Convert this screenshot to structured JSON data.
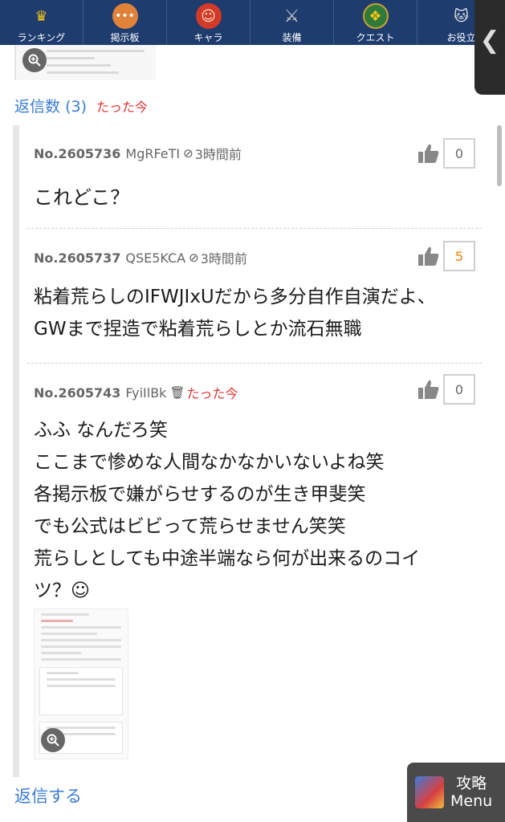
{
  "nav": {
    "items": [
      {
        "label": "ランキング",
        "icon": "crown-icon",
        "color": "#f5c518"
      },
      {
        "label": "掲示板",
        "icon": "chat-bubble-icon",
        "color": "#e0823a"
      },
      {
        "label": "キャラ",
        "icon": "character-face-icon",
        "color": "#d23a2a"
      },
      {
        "label": "装備",
        "icon": "sword-icon",
        "color": "#b8b8b8"
      },
      {
        "label": "クエスト",
        "icon": "quest-emblem-icon",
        "color": "#c8a030"
      },
      {
        "label": "お役立",
        "icon": "cat-icon",
        "color": "#eeeeee"
      }
    ]
  },
  "drawer": {
    "chevron": "❮"
  },
  "replies": {
    "label": "返信数",
    "count": "(3)",
    "ago": "たった今"
  },
  "posts": [
    {
      "no": "No.2605736",
      "id": "MgRFeTI",
      "icon": "ban-icon",
      "time": "3時間前",
      "likes": "0",
      "body": [
        "これどこ？"
      ]
    },
    {
      "no": "No.2605737",
      "id": "QSE5KCA",
      "icon": "ban-icon",
      "time": "3時間前",
      "likes": "5",
      "body": [
        "粘着荒らしのIFWJIxUだから多分自作自演だよ、",
        "GWまで捏造で粘着荒らしとか流石無職"
      ]
    },
    {
      "no": "No.2605743",
      "id": "FyiIlBk",
      "icon": "trash-icon",
      "time": "たった今",
      "likes": "0",
      "body": [
        "ふふ なんだろ笑",
        "ここまで惨めな人間なかなかいないよね笑",
        "各掲示板で嫌がらせするのが生き甲斐笑",
        "でも公式はビビって荒らせません笑笑",
        "荒らしとしても中途半端なら何が出来るのコイ",
        "ツ？☺"
      ]
    }
  ],
  "reply_action": "返信する",
  "guide": {
    "line1": "攻略",
    "line2": "Menu"
  },
  "colors": {
    "nav_bg": "#1e3c6e",
    "link": "#3a7bd5",
    "now": "#e03030",
    "hot_like": "#f07c00"
  }
}
